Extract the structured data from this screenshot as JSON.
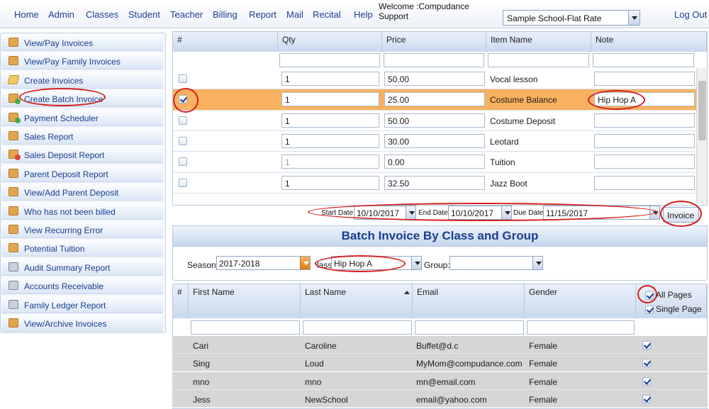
{
  "nav": {
    "links": [
      "Home",
      "Admin",
      "Classes",
      "Student",
      "Teacher",
      "Billing",
      "Report",
      "Mail",
      "Recital",
      "Help"
    ],
    "welcome_line1": "Welcome :Compudance",
    "welcome_line2": "Support",
    "school_value": "Sample School-Flat Rate",
    "logout": "Log Out"
  },
  "sidebar": {
    "items": [
      {
        "label": "View/Pay Invoices",
        "icon": "invoice-icon"
      },
      {
        "label": "View/Pay Family Invoices",
        "icon": "invoice-icon"
      },
      {
        "label": "Create Invoices",
        "icon": "pencil-icon"
      },
      {
        "label": "Create Batch Invoice",
        "icon": "invoice-add-icon"
      },
      {
        "label": "Payment Scheduler",
        "icon": "invoice-add-icon"
      },
      {
        "label": "Sales Report",
        "icon": "invoice-icon"
      },
      {
        "label": "Sales Deposit Report",
        "icon": "invoice-delete-icon"
      },
      {
        "label": "Parent Deposit Report",
        "icon": "invoice-icon"
      },
      {
        "label": "View/Add Parent Deposit",
        "icon": "invoice-icon"
      },
      {
        "label": "Who has not been billed",
        "icon": "invoice-icon"
      },
      {
        "label": "View Recurring Error",
        "icon": "invoice-icon"
      },
      {
        "label": "Potential Tuition",
        "icon": "invoice-icon"
      },
      {
        "label": "Audit Summary Report",
        "icon": "book-icon"
      },
      {
        "label": "Accounts Receivable",
        "icon": "book-icon"
      },
      {
        "label": "Family Ledger Report",
        "icon": "book-icon"
      },
      {
        "label": "View/Archive Invoices",
        "icon": "invoice-icon"
      }
    ]
  },
  "items_grid": {
    "headers": [
      "#",
      "Qty",
      "Price",
      "Item Name",
      "Note"
    ],
    "rows": [
      {
        "checked": false,
        "qty": "1",
        "price": "50.00",
        "item": "Vocal lesson",
        "note": ""
      },
      {
        "checked": true,
        "qty": "1",
        "price": "25.00",
        "item": "Costume Balance",
        "note": "Hip Hop A"
      },
      {
        "checked": false,
        "qty": "1",
        "price": "50.00",
        "item": "Costume Deposit",
        "note": ""
      },
      {
        "checked": false,
        "qty": "1",
        "price": "30.00",
        "item": "Leotard",
        "note": ""
      },
      {
        "checked": false,
        "qty": "1",
        "price": "0.00",
        "item": "Tuition",
        "note": ""
      },
      {
        "checked": false,
        "qty": "1",
        "price": "32.50",
        "item": "Jazz Boot",
        "note": ""
      }
    ]
  },
  "dates": {
    "start_label": "Start Date",
    "start_value": "10/10/2017",
    "end_label": "End Date",
    "end_value": "10/10/2017",
    "due_label": "Due Date:",
    "due_value": "11/15/2017",
    "invoice_button": "Invoice"
  },
  "batch": {
    "title": "Batch Invoice By Class and Group",
    "season_label": "Season:",
    "season_value": "2017-2018",
    "class_label_partial": "lass:",
    "class_value": "Hip Hop A",
    "group_label": "Group:",
    "group_value": ""
  },
  "students_grid": {
    "headers": [
      "#",
      "First Name",
      "Last Name",
      "Email",
      "Gender"
    ],
    "all_pages": "All Pages",
    "single_page": "Single Page",
    "rows": [
      {
        "first": "Cari",
        "last": "Caroline",
        "email": "Buffet@d.c",
        "gender": "Female"
      },
      {
        "first": "Sing",
        "last": "Loud",
        "email": "MyMom@compudance.com",
        "gender": "Female"
      },
      {
        "first": "mno",
        "last": "mno",
        "email": "mn@email.com",
        "gender": "Female"
      },
      {
        "first": "Jess",
        "last": "NewSchool",
        "email": "email@yahoo.com",
        "gender": "Female"
      }
    ]
  },
  "colors": {
    "link": "#1b3d8f",
    "selected_row": "#f8b15f",
    "annotation": "#d51f1f",
    "student_row": "#d6d6d6"
  }
}
